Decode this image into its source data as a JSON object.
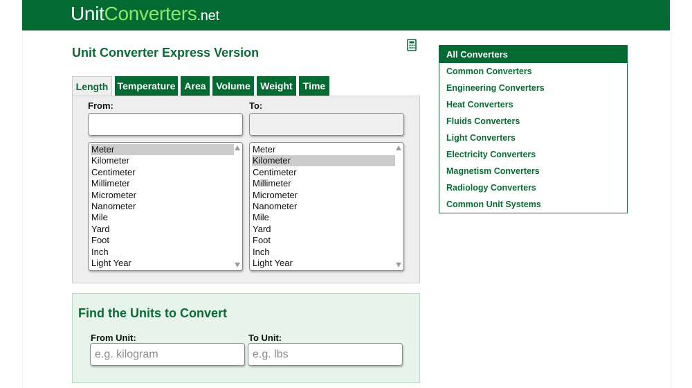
{
  "header": {
    "logo_unit": "Unit",
    "logo_converters": "Converters",
    "logo_net": ".net"
  },
  "page": {
    "title": "Unit Converter Express Version"
  },
  "tabs": [
    {
      "label": "Length",
      "active": true
    },
    {
      "label": "Temperature",
      "active": false
    },
    {
      "label": "Area",
      "active": false
    },
    {
      "label": "Volume",
      "active": false
    },
    {
      "label": "Weight",
      "active": false
    },
    {
      "label": "Time",
      "active": false
    }
  ],
  "converter": {
    "from_label": "From:",
    "to_label": "To:",
    "from_value": "",
    "to_value": "",
    "from_selected": "Meter",
    "to_selected": "Kilometer",
    "units": [
      "Meter",
      "Kilometer",
      "Centimeter",
      "Millimeter",
      "Micrometer",
      "Nanometer",
      "Mile",
      "Yard",
      "Foot",
      "Inch",
      "Light Year"
    ]
  },
  "find": {
    "title": "Find the Units to Convert",
    "from_label": "From Unit:",
    "to_label": "To Unit:",
    "from_placeholder": "e.g. kilogram",
    "to_placeholder": "e.g. lbs"
  },
  "sidebar": {
    "heading": "All Converters",
    "items": [
      "Common Converters",
      "Engineering Converters",
      "Heat Converters",
      "Fluids Converters",
      "Light Converters",
      "Electricity Converters",
      "Magnetism Converters",
      "Radiology Converters",
      "Common Unit Systems"
    ]
  },
  "colors": {
    "brand_green": "#036b32",
    "logo_light_green": "#8ee86e",
    "text_green": "#0b6b34",
    "find_bg": "#e6f4ec"
  }
}
